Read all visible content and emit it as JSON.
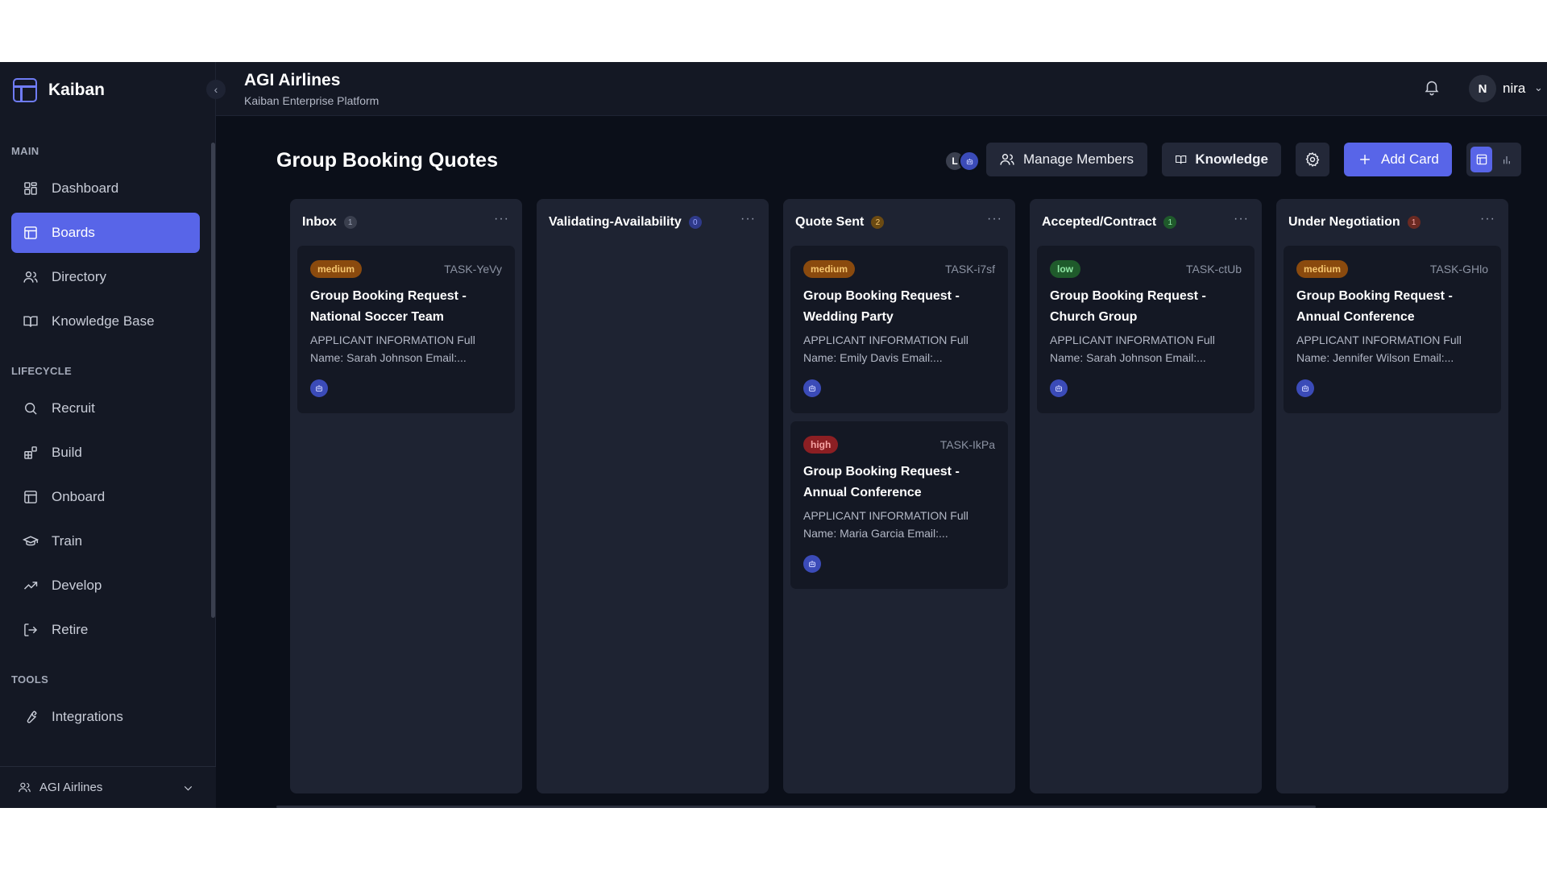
{
  "brand": {
    "name": "Kaiban"
  },
  "topbar": {
    "org_title": "AGI Airlines",
    "org_subtitle": "Kaiban Enterprise Platform",
    "user_initial": "N",
    "user_name": "nira"
  },
  "sidebar": {
    "sections": [
      {
        "label": "MAIN",
        "items": [
          {
            "label": "Dashboard",
            "icon": "dashboard-icon",
            "active": false
          },
          {
            "label": "Boards",
            "icon": "board-icon",
            "active": true
          },
          {
            "label": "Directory",
            "icon": "users-icon",
            "active": false
          },
          {
            "label": "Knowledge Base",
            "icon": "book-icon",
            "active": false
          }
        ]
      },
      {
        "label": "LIFECYCLE",
        "items": [
          {
            "label": "Recruit",
            "icon": "search-icon",
            "active": false
          },
          {
            "label": "Build",
            "icon": "blocks-icon",
            "active": false
          },
          {
            "label": "Onboard",
            "icon": "layout-icon",
            "active": false
          },
          {
            "label": "Train",
            "icon": "graduation-cap-icon",
            "active": false
          },
          {
            "label": "Develop",
            "icon": "trending-up-icon",
            "active": false
          },
          {
            "label": "Retire",
            "icon": "logout-icon",
            "active": false
          }
        ]
      },
      {
        "label": "TOOLS",
        "items": [
          {
            "label": "Integrations",
            "icon": "wrench-icon",
            "active": false
          }
        ]
      }
    ],
    "org_switch_label": "AGI Airlines"
  },
  "board": {
    "title": "Group Booking Quotes",
    "member_initial": "L",
    "manage_members_label": "Manage Members",
    "knowledge_label": "Knowledge",
    "add_card_label": "Add Card"
  },
  "columns": [
    {
      "title": "Inbox",
      "count": "1",
      "count_color": "#3a3f4e",
      "count_text": "#9aa1b3",
      "cards": [
        {
          "priority": "medium",
          "task_id": "TASK-YeVy",
          "title": "Group Booking Request - National Soccer Team",
          "desc": "APPLICANT INFORMATION Full Name: Sarah Johnson Email:..."
        }
      ]
    },
    {
      "title": "Validating-Availability",
      "count": "0",
      "count_color": "#2f3a8a",
      "count_text": "#9aa6ff",
      "cards": []
    },
    {
      "title": "Quote Sent",
      "count": "2",
      "count_color": "#6b4a12",
      "count_text": "#f6c66e",
      "cards": [
        {
          "priority": "medium",
          "task_id": "TASK-i7sf",
          "title": "Group Booking Request - Wedding Party",
          "desc": "APPLICANT INFORMATION Full Name: Emily Davis Email:..."
        },
        {
          "priority": "high",
          "task_id": "TASK-IkPa",
          "title": "Group Booking Request - Annual Conference",
          "desc": "APPLICANT INFORMATION Full Name: Maria Garcia Email:..."
        }
      ]
    },
    {
      "title": "Accepted/Contract",
      "count": "1",
      "count_color": "#1f5a2b",
      "count_text": "#8fe6a4",
      "cards": [
        {
          "priority": "low",
          "task_id": "TASK-ctUb",
          "title": "Group Booking Request - Church Group",
          "desc": "APPLICANT INFORMATION Full Name: Sarah Johnson Email:..."
        }
      ]
    },
    {
      "title": "Under Negotiation",
      "count": "1",
      "count_color": "#6b2a22",
      "count_text": "#f6a3a3",
      "cards": [
        {
          "priority": "medium",
          "task_id": "TASK-GHlo",
          "title": "Group Booking Request - Annual Conference",
          "desc": "APPLICANT INFORMATION Full Name: Jennifer Wilson Email:..."
        }
      ]
    }
  ]
}
